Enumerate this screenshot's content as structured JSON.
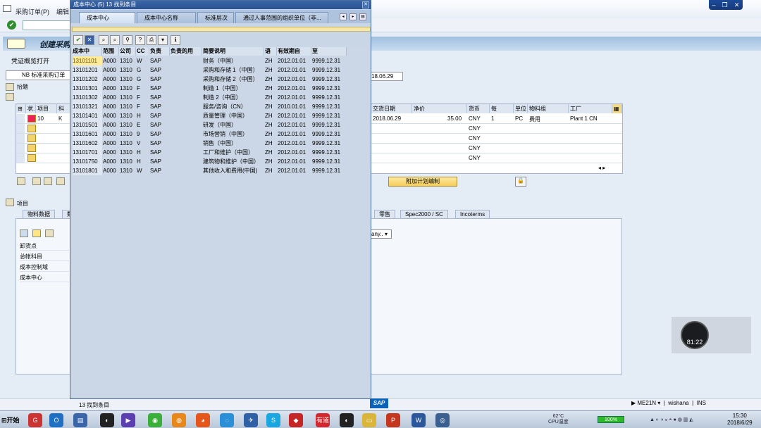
{
  "menu": {
    "items": [
      "采购订单(P)",
      "编辑"
    ]
  },
  "main": {
    "title": "创建采购",
    "toolbar_label": "凭证概览打开",
    "order_type": "NB 标准采购订单",
    "doc_date": "18.06.29",
    "header_label": "抬题",
    "grid_headers": [
      "状.",
      "项目",
      "科"
    ],
    "grid_right_headers": [
      "交货日期",
      "净价",
      "货币",
      "每",
      "单位",
      "物料组",
      "工厂"
    ],
    "first_item": {
      "no": "10",
      "acct": "K",
      "date": "2018.06.29",
      "price": "35.00",
      "currency": "CNY",
      "per": "1",
      "unit": "PC",
      "group": "费用",
      "plant": "Plant 1 CN"
    },
    "extra_currency": [
      "CNY",
      "CNY",
      "CNY",
      "CNY"
    ],
    "plan_button": "附加计划编制",
    "item_section": "项目",
    "tabs": [
      "物料数据",
      "数",
      "零售",
      "Spec2000 / SC",
      "Incoterms"
    ],
    "account_labels": [
      "卸货点",
      "总帐科目",
      "成本控制域",
      "成本中心"
    ],
    "dropdown_any": "any..",
    "status_tx": "ME21N",
    "status_user": "wishana",
    "status_mode": "INS"
  },
  "popup": {
    "title": "成本中心 (5)   13 找到条目",
    "tabs": [
      "成本中心",
      "成本中心名称",
      "标准层次",
      "通过人事范围的组织单位（非..."
    ],
    "columns": [
      "成本中",
      "范围",
      "公司",
      "CC",
      "负责",
      "负责的用",
      "简要说明",
      "语",
      "有效期自",
      "至"
    ],
    "rows": [
      [
        "13101101",
        "A000",
        "1310",
        "W",
        "SAP",
        "",
        "财务（中国）",
        "ZH",
        "2012.01.01",
        "9999.12.31"
      ],
      [
        "13101201",
        "A000",
        "1310",
        "G",
        "SAP",
        "",
        "采购和存储 1（中国）",
        "ZH",
        "2012.01.01",
        "9999.12.31"
      ],
      [
        "13101202",
        "A000",
        "1310",
        "G",
        "SAP",
        "",
        "采购和存储 2（中国）",
        "ZH",
        "2012.01.01",
        "9999.12.31"
      ],
      [
        "13101301",
        "A000",
        "1310",
        "F",
        "SAP",
        "",
        "制造 1（中国）",
        "ZH",
        "2012.01.01",
        "9999.12.31"
      ],
      [
        "13101302",
        "A000",
        "1310",
        "F",
        "SAP",
        "",
        "制造 2（中国）",
        "ZH",
        "2012.01.01",
        "9999.12.31"
      ],
      [
        "13101321",
        "A000",
        "1310",
        "F",
        "SAP",
        "",
        "服务/咨询（CN）",
        "ZH",
        "2010.01.01",
        "9999.12.31"
      ],
      [
        "13101401",
        "A000",
        "1310",
        "H",
        "SAP",
        "",
        "质量管理（中国）",
        "ZH",
        "2012.01.01",
        "9999.12.31"
      ],
      [
        "13101501",
        "A000",
        "1310",
        "E",
        "SAP",
        "",
        "研发（中国）",
        "ZH",
        "2012.01.01",
        "9999.12.31"
      ],
      [
        "13101601",
        "A000",
        "1310",
        "9",
        "SAP",
        "",
        "市场营销（中国）",
        "ZH",
        "2012.01.01",
        "9999.12.31"
      ],
      [
        "13101602",
        "A000",
        "1310",
        "V",
        "SAP",
        "",
        "销售（中国）",
        "ZH",
        "2012.01.01",
        "9999.12.31"
      ],
      [
        "13101701",
        "A000",
        "1310",
        "H",
        "SAP",
        "",
        "工厂和维护（中国）",
        "ZH",
        "2012.01.01",
        "9999.12.31"
      ],
      [
        "13101750",
        "A000",
        "1310",
        "H",
        "SAP",
        "",
        "建筑物和维护（中国）",
        "ZH",
        "2012.01.01",
        "9999.12.31"
      ],
      [
        "13101801",
        "A000",
        "1310",
        "W",
        "SAP",
        "",
        "其他收入和费用(中国)",
        "ZH",
        "2012.01.01",
        "9999.12.31"
      ]
    ],
    "status": "13 找到条目"
  },
  "recorder": {
    "time": "81:22"
  },
  "taskbar": {
    "start": "开始",
    "battery": "100%",
    "temp": "62°C",
    "temp_label": "CPU温度",
    "time": "15:30",
    "date": "2018/6/29",
    "youdao": "有道"
  },
  "sap_logo": "SAP"
}
